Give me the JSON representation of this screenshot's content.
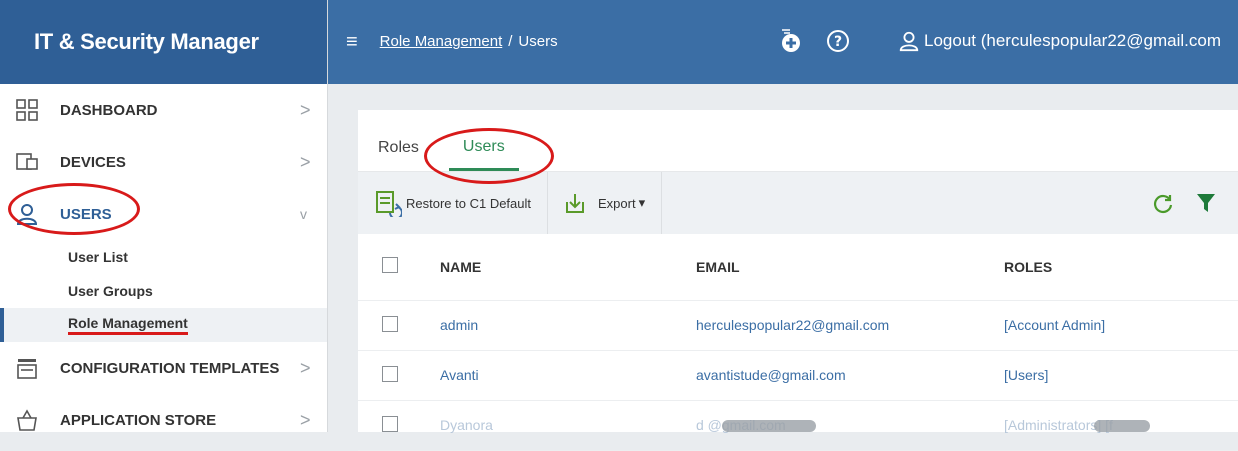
{
  "brand": {
    "title": "IT & Security Manager"
  },
  "sidebar": {
    "items": [
      {
        "label": "DASHBOARD",
        "icon": "dashboard-icon",
        "chevron": ">"
      },
      {
        "label": "DEVICES",
        "icon": "devices-icon",
        "chevron": ">"
      },
      {
        "label": "USERS",
        "icon": "user-icon",
        "chevron": "v",
        "children": [
          "User List",
          "User Groups",
          "Role Management"
        ]
      },
      {
        "label": "CONFIGURATION TEMPLATES",
        "icon": "templates-icon",
        "chevron": ">"
      },
      {
        "label": "APPLICATION STORE",
        "icon": "store-icon",
        "chevron": ">"
      }
    ]
  },
  "topbar": {
    "crumb_link": "Role Management",
    "crumb_sep": "/",
    "crumb_current": "Users",
    "logout_label": "Logout (herculespopular22@gmail.com"
  },
  "tabs": [
    "Roles",
    "Users"
  ],
  "toolbar": {
    "restore_label": "Restore to C1 Default",
    "export_label": "Export",
    "export_caret": "▾"
  },
  "table": {
    "columns": [
      "NAME",
      "EMAIL",
      "ROLES"
    ],
    "rows": [
      {
        "name": "admin",
        "email": "herculespopular22@gmail.com",
        "roles": "[Account Admin]"
      },
      {
        "name": "Avanti",
        "email": "avantistude@gmail.com",
        "roles": "[Users]"
      },
      {
        "name": "Dyanora",
        "email": "d         @gmail.com",
        "roles": "[Administrators] [f"
      }
    ]
  },
  "colors": {
    "brand": "#2f5f96",
    "topbar": "#3b6ea5",
    "accent": "#2e8b57",
    "annotation": "#d81a1a"
  }
}
